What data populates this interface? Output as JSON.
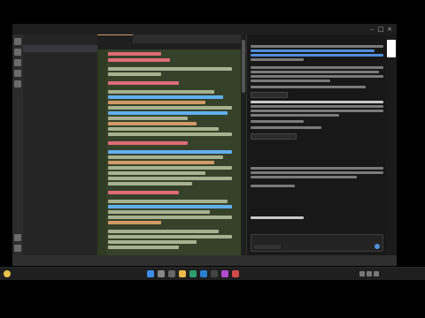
{
  "window": {
    "title": "",
    "min_glyph": "–",
    "max_glyph": "□",
    "close_glyph": "×"
  },
  "explorer": {
    "header": "",
    "items": [
      {
        "label": ""
      }
    ]
  },
  "editor": {
    "tabs": [
      {
        "label": "",
        "active": true
      },
      {
        "label": "",
        "active": false
      }
    ],
    "breadcrumb": ""
  },
  "chat": {
    "title": "",
    "input_placeholder": ""
  },
  "taskbar": {
    "weather_temp": "",
    "weather_desc": "",
    "time": "",
    "date": ""
  },
  "colors": {
    "editor_bg": "#1e1e1e",
    "highlight_bg": "#36412a",
    "heading": "#e06c75",
    "link": "#61afef",
    "accent": "#4f8fdc"
  },
  "icons": {
    "activity": [
      "files-icon",
      "search-icon",
      "source-control-icon",
      "debug-icon",
      "extensions-icon"
    ],
    "taskbar": [
      "start-icon",
      "search-icon",
      "task-view-icon",
      "file-explorer-icon",
      "browser-icon",
      "vscode-icon",
      "terminal-icon"
    ]
  }
}
